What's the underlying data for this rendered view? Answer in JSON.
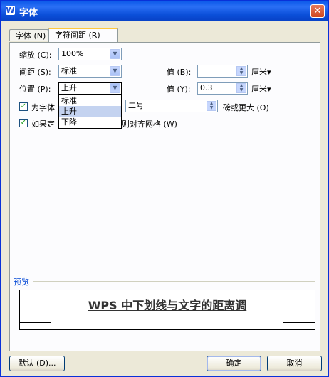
{
  "window": {
    "title": "字体",
    "app_icon": "W"
  },
  "tabs": [
    {
      "label": "字体 (N)"
    },
    {
      "label": "字符间距 (R)"
    }
  ],
  "form": {
    "scale_label": "缩放 (C):",
    "scale_value": "100%",
    "spacing_label": "间距 (S):",
    "spacing_value": "标准",
    "position_label": "位置 (P):",
    "position_value": "上升",
    "value_b_label": "值 (B):",
    "value_b_value": "",
    "value_b_unit": "厘米▾",
    "value_y_label": "值 (Y):",
    "value_y_value": "0.3",
    "value_y_unit": "厘米▾",
    "kerning_label": "为字体",
    "kerning_size": "二号",
    "kerning_suffix": "磅或更大 (O)",
    "grid_label": "如果定",
    "grid_suffix": "则对齐网格 (W)"
  },
  "dropdown": {
    "options": [
      "标准",
      "上升",
      "下降"
    ],
    "selected": "上升"
  },
  "preview": {
    "label": "预览",
    "text": "WPS 中下划线与文字的距离调"
  },
  "buttons": {
    "default": "默认 (D)...",
    "ok": "确定",
    "cancel": "取消"
  }
}
